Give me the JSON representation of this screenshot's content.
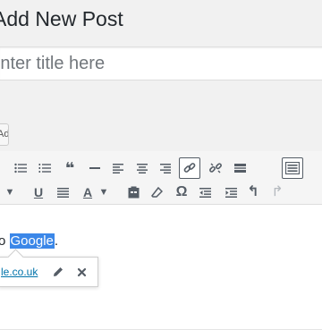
{
  "page": {
    "title": "Add New Post"
  },
  "title_field": {
    "placeholder": "Enter title here"
  },
  "media_tab": {
    "label": "Add Media"
  },
  "toolbar": {
    "row1": [
      {
        "name": "bulleted-list-icon",
        "glyph": "☰",
        "active": false
      },
      {
        "name": "numbered-list-icon",
        "glyph": "☰",
        "active": false
      },
      {
        "name": "blockquote-icon",
        "glyph": "❝",
        "active": false
      },
      {
        "name": "horizontal-line-icon",
        "glyph": "—",
        "active": false
      },
      {
        "name": "align-left-icon",
        "glyph": "☰",
        "active": false
      },
      {
        "name": "align-center-icon",
        "glyph": "☰",
        "active": false
      },
      {
        "name": "align-right-icon",
        "glyph": "☰",
        "active": false
      },
      {
        "name": "insert-link-icon",
        "glyph": "🔗",
        "active": true
      },
      {
        "name": "remove-link-icon",
        "glyph": "⛓",
        "active": false
      },
      {
        "name": "read-more-icon",
        "glyph": "☰",
        "active": false
      },
      {
        "name": "toolbar-toggle-icon",
        "glyph": "▦",
        "active": true
      }
    ],
    "row2": [
      {
        "name": "format-dropdown-arrow-icon",
        "glyph": "▾",
        "active": false
      },
      {
        "name": "underline-icon",
        "glyph": "U",
        "active": false
      },
      {
        "name": "justify-icon",
        "glyph": "≡",
        "active": false
      },
      {
        "name": "text-color-icon",
        "glyph": "A",
        "active": false
      },
      {
        "name": "text-color-dropdown-icon",
        "glyph": "▾",
        "active": false
      },
      {
        "name": "paste-as-text-icon",
        "glyph": "📋",
        "active": false
      },
      {
        "name": "clear-formatting-icon",
        "glyph": "⌫",
        "active": false
      },
      {
        "name": "special-character-icon",
        "glyph": "Ω",
        "active": false
      },
      {
        "name": "outdent-icon",
        "glyph": "⇤",
        "active": false
      },
      {
        "name": "indent-icon",
        "glyph": "⇥",
        "active": false
      },
      {
        "name": "undo-icon",
        "glyph": "↶",
        "active": false
      },
      {
        "name": "redo-icon",
        "glyph": "↷",
        "active": false
      }
    ]
  },
  "editor": {
    "text_before": "o ",
    "selected_text": "Google",
    "text_after": "."
  },
  "link_tooltip": {
    "url": "le.co.uk",
    "edit_icon": "✎",
    "remove_icon": "✖"
  },
  "colors": {
    "accent": "#0073aa",
    "selection": "#3b87e8",
    "icon": "#555d66"
  }
}
